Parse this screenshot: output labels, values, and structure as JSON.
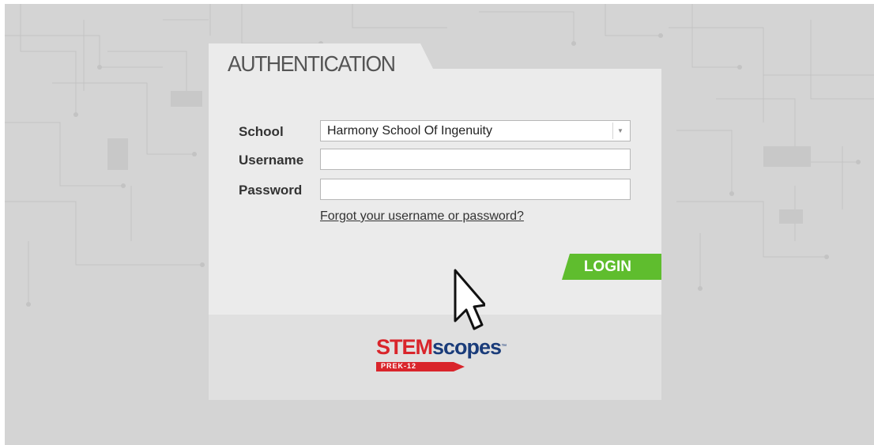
{
  "login": {
    "heading": "AUTHENTICATION",
    "fields": {
      "school_label": "School",
      "school_value": "Harmony School Of Ingenuity",
      "username_label": "Username",
      "username_value": "",
      "password_label": "Password",
      "password_value": ""
    },
    "forgot_link": "Forgot your username or password?",
    "login_button": "LOGIN"
  },
  "brand": {
    "logo_primary": "STEM",
    "logo_secondary": "scopes",
    "logo_trademark": "™",
    "logo_subtitle": "PREK-12"
  },
  "colors": {
    "accent_green": "#5fbd2e",
    "logo_red": "#d9252b",
    "logo_blue": "#1a3c7a",
    "background": "#d4d4d4",
    "panel": "#ebebeb"
  },
  "icons": {
    "dropdown": "chevron-down-icon",
    "cursor": "mouse-pointer-icon"
  }
}
